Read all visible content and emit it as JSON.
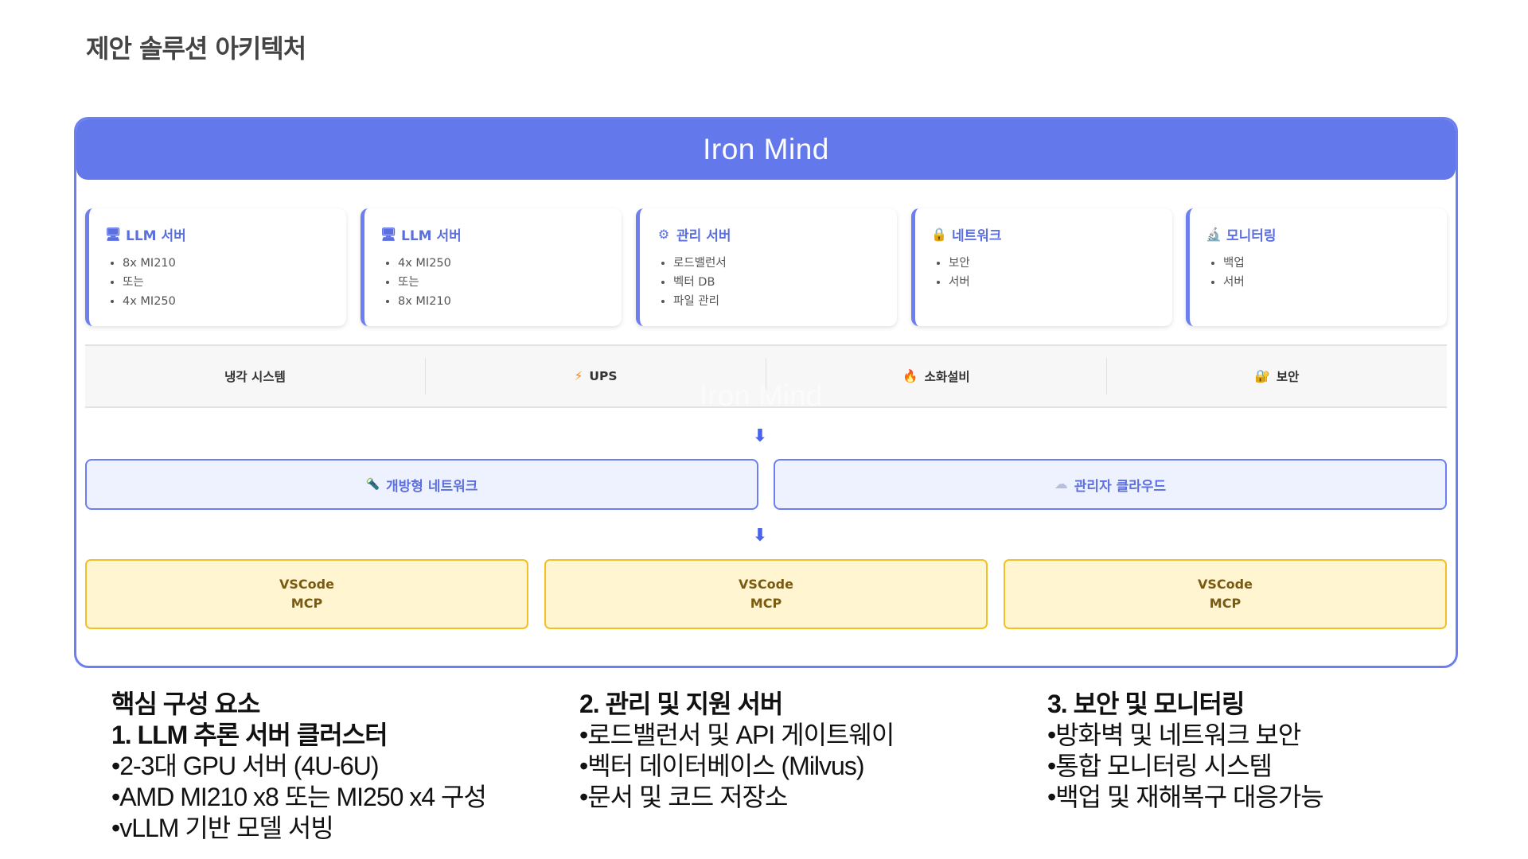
{
  "page_title": "제안 솔루션 아키텍처",
  "diagram": {
    "header_title": "Iron Mind",
    "watermark": "Iron Mind",
    "cards": [
      {
        "icon": "computer-icon",
        "glyph": "🖥",
        "title": "LLM 서버",
        "items": [
          "8x MI210",
          "또는",
          "4x MI250"
        ]
      },
      {
        "icon": "computer-icon",
        "glyph": "🖥",
        "title": "LLM 서버",
        "items": [
          "4x MI250",
          "또는",
          "8x MI210"
        ]
      },
      {
        "icon": "gear-icon",
        "glyph": "⚙",
        "title": "관리 서버",
        "items": [
          "로드밸런서",
          "벡터 DB",
          "파일 관리"
        ]
      },
      {
        "icon": "lock-icon",
        "glyph": "🔒",
        "title": "네트워크",
        "items": [
          "보안",
          "서버"
        ]
      },
      {
        "icon": "microscope-icon",
        "glyph": "🔬",
        "title": "모니터링",
        "items": [
          "백업",
          "서버"
        ]
      }
    ],
    "infra": [
      {
        "icon": "",
        "glyph": "",
        "label": "냉각 시스템"
      },
      {
        "icon": "lightning-icon",
        "glyph": "⚡",
        "label": "UPS"
      },
      {
        "icon": "fire-icon",
        "glyph": "🔥",
        "label": "소화설비"
      },
      {
        "icon": "lock-icon",
        "glyph": "🔐",
        "label": "보안"
      }
    ],
    "arrow_glyph": "⬇",
    "networks": [
      {
        "icon": "torch-icon",
        "glyph": "🔦",
        "label": "개방형 네트워크"
      },
      {
        "icon": "cloud-icon",
        "glyph": "☁",
        "label": "관리자 클라우드"
      }
    ],
    "clients": [
      {
        "line1": "VSCode",
        "line2": "MCP"
      },
      {
        "line1": "VSCode",
        "line2": "MCP"
      },
      {
        "line1": "VSCode",
        "line2": "MCP"
      }
    ]
  },
  "summary": {
    "col1": {
      "heading": "핵심 구성 요소",
      "subheading": "1. LLM 추론 서버 클러스터",
      "lines": [
        "•2-3대 GPU 서버 (4U-6U)",
        "•AMD MI210 x8 또는 MI250 x4 구성",
        "•vLLM 기반 모델 서빙"
      ]
    },
    "col2": {
      "heading": "2. 관리 및 지원 서버",
      "lines": [
        "•로드밸런서 및 API 게이트웨이",
        "•벡터 데이터베이스 (Milvus)",
        "•문서 및 코드 저장소"
      ]
    },
    "col3": {
      "heading": "3. 보안 및 모니터링",
      "lines": [
        "•방화벽 및 네트워크 보안",
        "•통합 모니터링 시스템",
        "•백업 및 재해복구 대응가능"
      ]
    }
  }
}
